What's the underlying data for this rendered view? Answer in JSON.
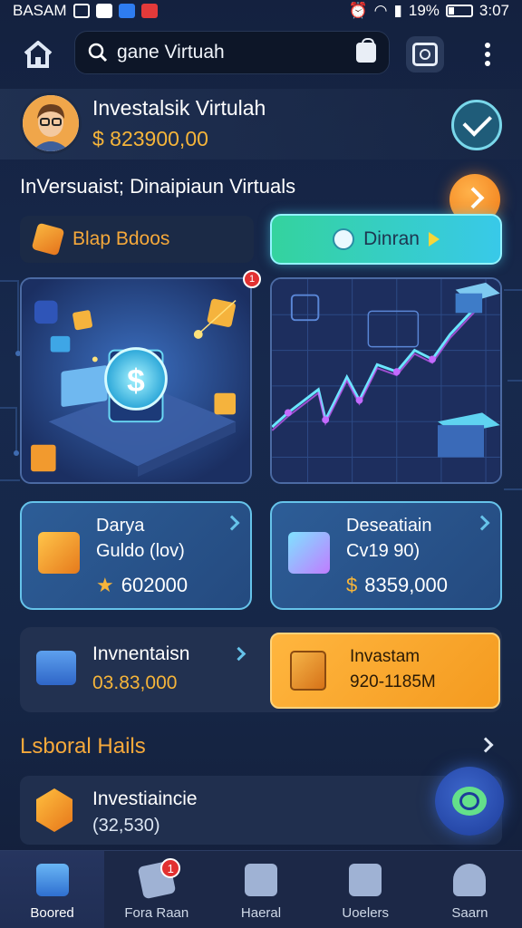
{
  "status_bar": {
    "carrier": "BASAM",
    "battery": "19%",
    "time": "3:07"
  },
  "search": {
    "query": "gane Virtuah"
  },
  "profile": {
    "name": "Investalsik Virtulah",
    "balance": "$ 823900,00"
  },
  "headline": "InVersuaist; Dinaipiaun Virtuals",
  "actions": {
    "blip_label": "Blap Bdoos",
    "primary_label": "Dinran"
  },
  "badges": {
    "image_card_dot": "1",
    "nav_badge": "1"
  },
  "stats": [
    {
      "title": "Darya",
      "subtitle": "Guldo (lov)",
      "currency": "★",
      "value": "602000"
    },
    {
      "title": "Deseatiain",
      "subtitle": "Cv19 90)",
      "currency": "$",
      "value": "8359,000"
    }
  ],
  "investment": {
    "title": "Invnentaisn",
    "value": "03.83,000",
    "button_title": "Invastam",
    "button_value": "920-1185M"
  },
  "section": {
    "title": "Lsboral Hails"
  },
  "list_items": [
    {
      "title": "Investiaincie",
      "value": "(32,530)"
    }
  ],
  "bottom_nav": [
    {
      "label": "Boored",
      "icon": "building-icon",
      "active": true
    },
    {
      "label": "Fora Raan",
      "icon": "ticket-icon",
      "active": false
    },
    {
      "label": "Haeral",
      "icon": "list-icon",
      "active": false
    },
    {
      "label": "Uoelers",
      "icon": "folder-icon",
      "active": false
    },
    {
      "label": "Saarn",
      "icon": "user-icon",
      "active": false
    }
  ],
  "colors": {
    "accent_orange": "#f6a93b",
    "accent_teal": "#38c9e9",
    "background": "#17294d"
  }
}
